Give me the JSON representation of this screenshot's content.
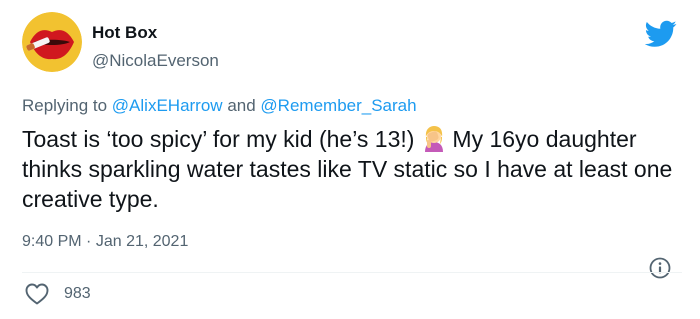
{
  "author": {
    "display_name": "Hot Box",
    "handle": "@NicolaEverson",
    "avatar_icon": "red-lips-avatar"
  },
  "brand": {
    "icon": "twitter-bird-icon",
    "color": "#1d9bf0"
  },
  "reply": {
    "prefix": "Replying to",
    "mention_1": "@AlixEHarrow",
    "joiner": "and",
    "mention_2": "@Remember_Sarah"
  },
  "tweet": {
    "text_part_1": "Toast is ‘too spicy’ for my kid (he’s 13!)",
    "emoji": "woman-facepalming-emoji",
    "text_part_2": "My 16yo daughter thinks sparkling water tastes like TV static so I have at least one creative type."
  },
  "meta": {
    "time": "9:40 PM",
    "separator": "·",
    "date": "Jan 21, 2021"
  },
  "engagement": {
    "like_count": "983"
  },
  "colors": {
    "text": "#0f1419",
    "secondary": "#536471",
    "link": "#1d9bf0",
    "avatar_bg": "#f2c230",
    "lips": "#d0181f"
  }
}
